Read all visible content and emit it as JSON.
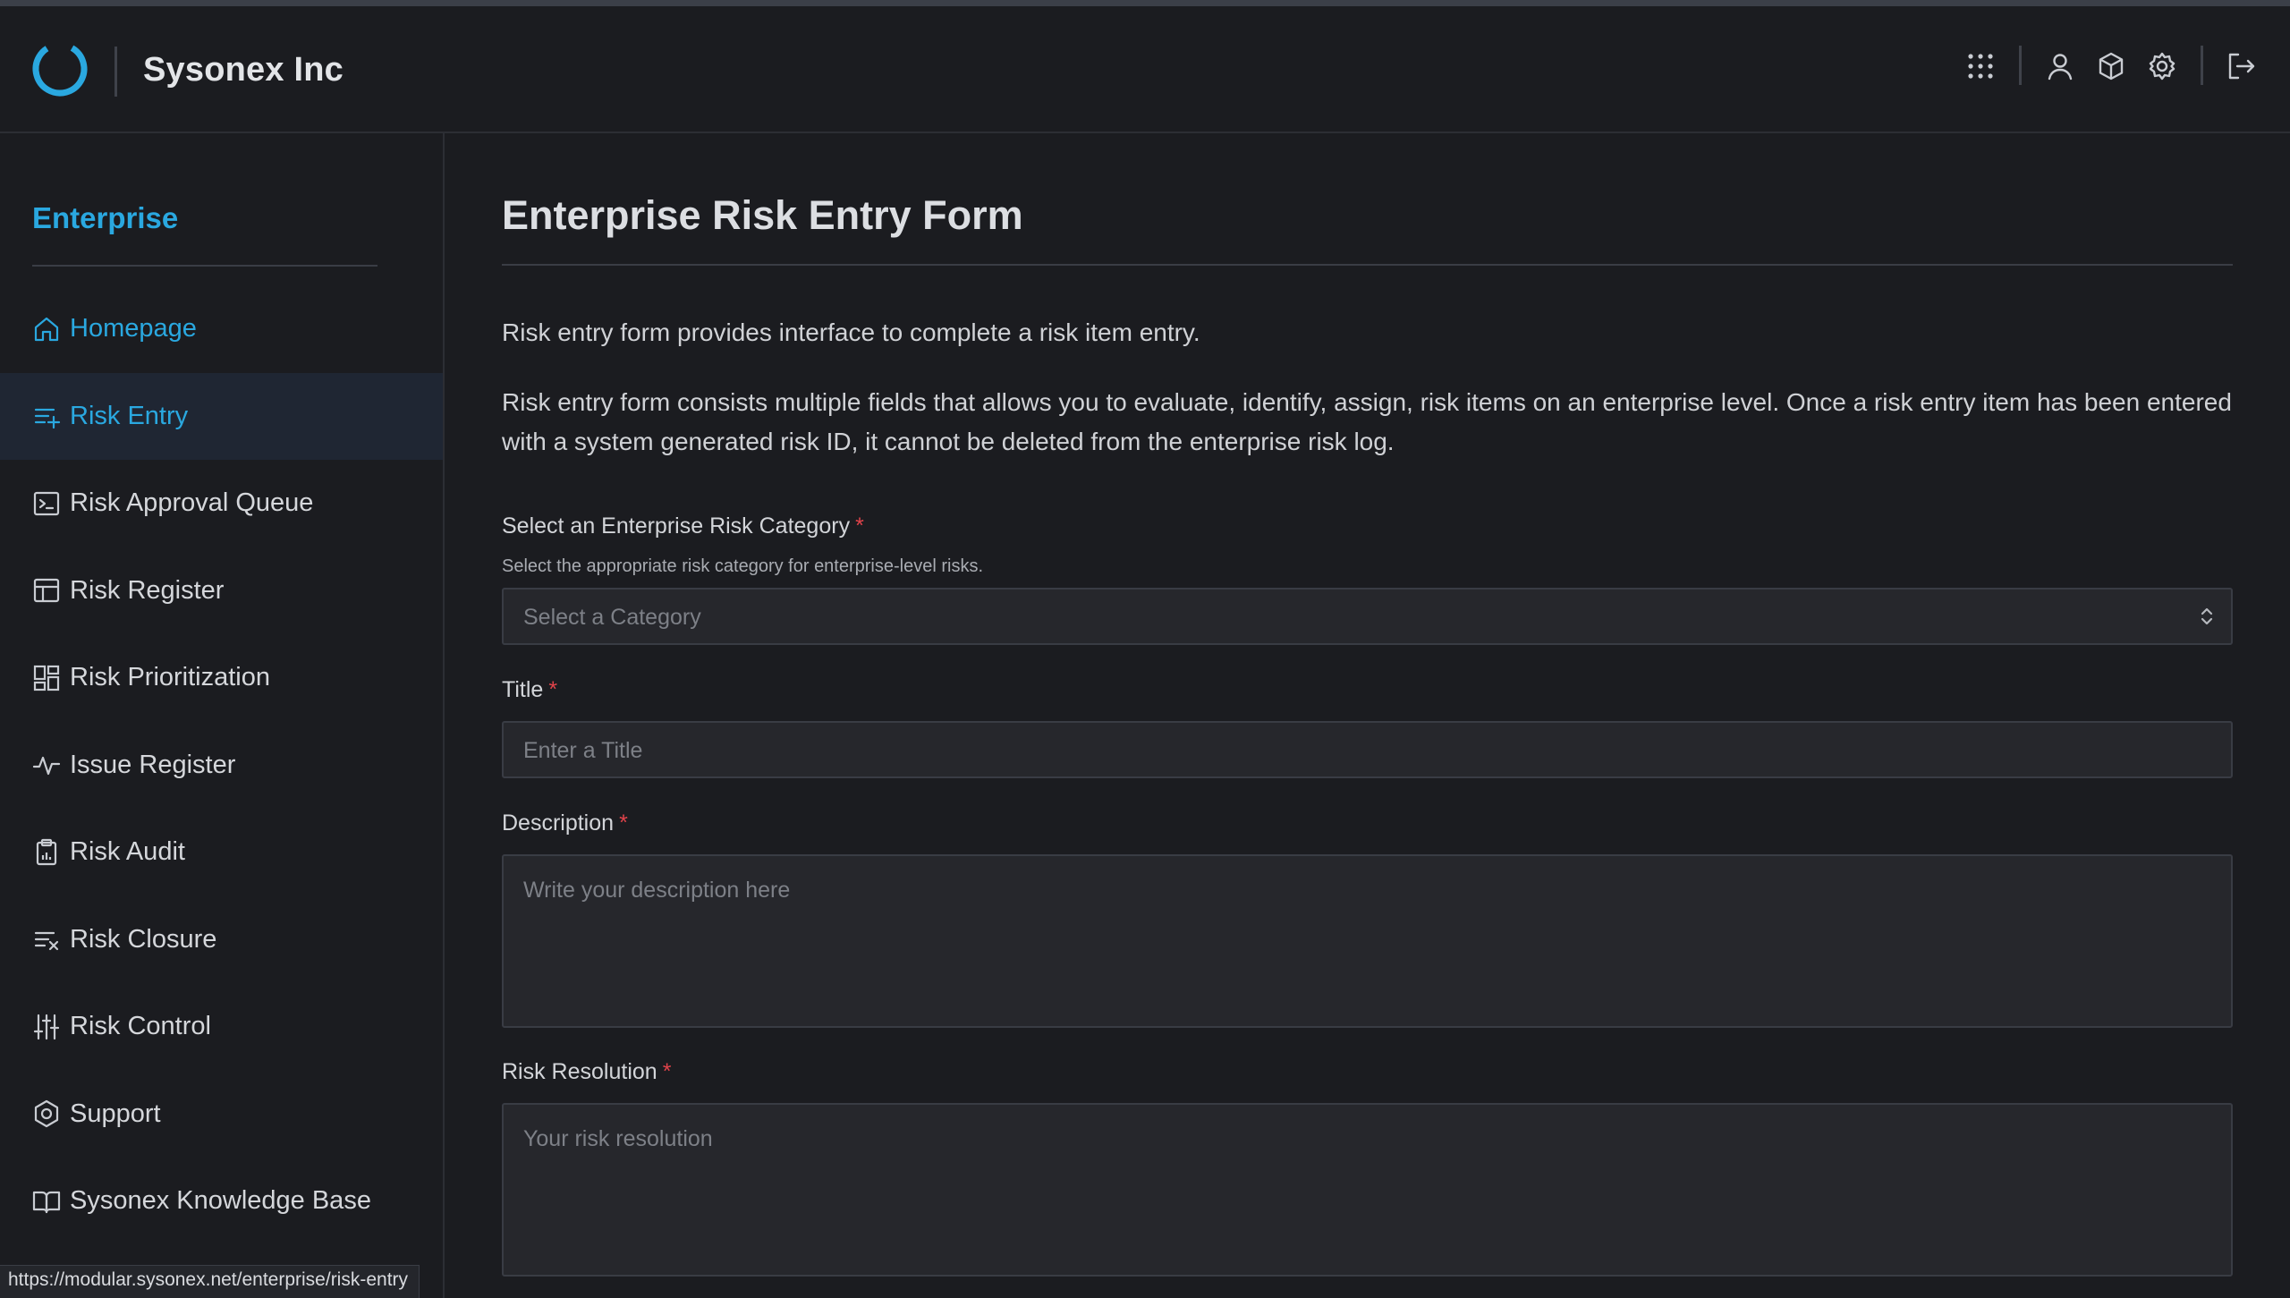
{
  "header": {
    "company": "Sysonex Inc",
    "icons": [
      "apps-grid-icon",
      "user-icon",
      "package-icon",
      "settings-icon",
      "logout-icon"
    ]
  },
  "sidebar": {
    "title": "Enterprise",
    "items": [
      {
        "label": "Homepage",
        "icon": "home-icon"
      },
      {
        "label": "Risk Entry",
        "icon": "list-add-icon"
      },
      {
        "label": "Risk Approval Queue",
        "icon": "terminal-icon"
      },
      {
        "label": "Risk Register",
        "icon": "table-icon"
      },
      {
        "label": "Risk Prioritization",
        "icon": "dashboard-icon"
      },
      {
        "label": "Issue Register",
        "icon": "activity-icon"
      },
      {
        "label": "Risk Audit",
        "icon": "clipboard-icon"
      },
      {
        "label": "Risk Closure",
        "icon": "list-x-icon"
      },
      {
        "label": "Risk Control",
        "icon": "sliders-icon"
      },
      {
        "label": "Support",
        "icon": "support-icon"
      },
      {
        "label": "Sysonex Knowledge Base",
        "icon": "book-icon"
      }
    ]
  },
  "main": {
    "title": "Enterprise Risk Entry Form",
    "intro": "Risk entry form provides interface to complete a risk item entry.",
    "details": "Risk entry form consists multiple fields that allows you to evaluate, identify, assign, risk items on an enterprise level. Once a risk entry item has been entered with a system generated risk ID, it cannot be deleted from the enterprise risk log.",
    "category": {
      "label": "Select an Enterprise Risk Category",
      "help": "Select the appropriate risk category for enterprise-level risks.",
      "placeholder": "Select a Category"
    },
    "title_field": {
      "label": "Title",
      "placeholder": "Enter a Title"
    },
    "description": {
      "label": "Description",
      "placeholder": "Write your description here"
    },
    "resolution": {
      "label": "Risk Resolution",
      "placeholder": "Your risk resolution"
    },
    "required_mark": "*"
  },
  "status_url": "https://modular.sysonex.net/enterprise/risk-entry",
  "colors": {
    "accent": "#2aa8e0",
    "background": "#1b1c20",
    "required": "#e0434a",
    "active_nav": "#1f2633"
  }
}
